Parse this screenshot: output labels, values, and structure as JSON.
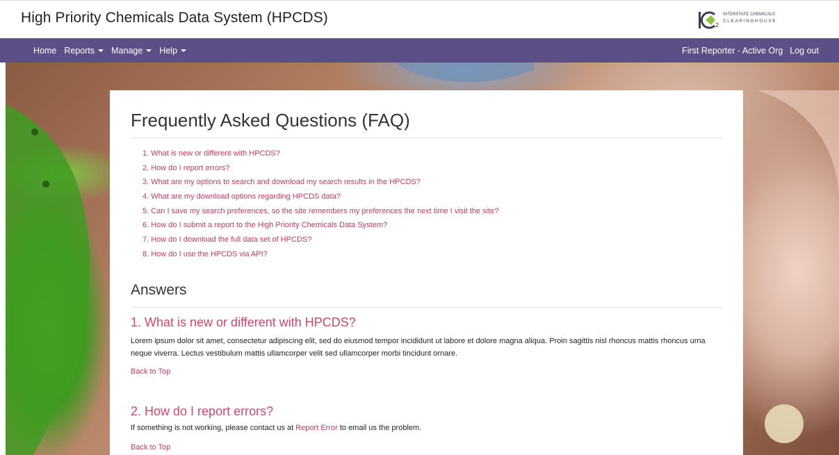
{
  "header": {
    "title": "High Priority Chemicals Data System (HPCDS)",
    "logo": {
      "mark": "IC2",
      "line1": "INTERSTATE CHEMICALS",
      "line2": "CLEARINGHOUSE"
    }
  },
  "nav": {
    "home": "Home",
    "reports": "Reports",
    "manage": "Manage",
    "help": "Help",
    "user": "First Reporter - Active Org",
    "logout": "Log out"
  },
  "faq": {
    "title": "Frequently Asked Questions (FAQ)",
    "questions": [
      "1. What is new or different with HPCDS?",
      "2. How do I report errors?",
      "3. What are my options to search and download my search results in the HPCDS?",
      "4. What are my download options regarding HPCDS data?",
      "5. Can I save my search preferences, so the site remembers my preferences the next time I visit the site?",
      "6. How do I submit a report to the High Priority Chemicals Data System?",
      "7. How do I download the full data set of HPCDS?",
      "8. How do I use the HPCDS via API?"
    ],
    "answers_title": "Answers",
    "answers": [
      {
        "heading": "1. What is new or different with HPCDS?",
        "body": "Lorem ipsum dolor sit amet, consectetur adipiscing elit, sed do eiusmod tempor incididunt ut labore et dolore magna aliqua. Proin sagittis nisl rhoncus mattis rhoncus urna neque viverra. Lectus vestibulum mattis ullamcorper velit sed ullamcorper morbi tincidunt ornare.",
        "back": "Back to Top"
      },
      {
        "heading": "2. How do I report errors?",
        "body_pre": "If something is not working, please contact us at ",
        "body_link": "Report Error",
        "body_post": " to email us the problem.",
        "back": "Back to Top"
      }
    ]
  },
  "colors": {
    "nav_bg": "#5c4e86",
    "link": "#c73b5c",
    "answer_heading": "#d6466a"
  }
}
